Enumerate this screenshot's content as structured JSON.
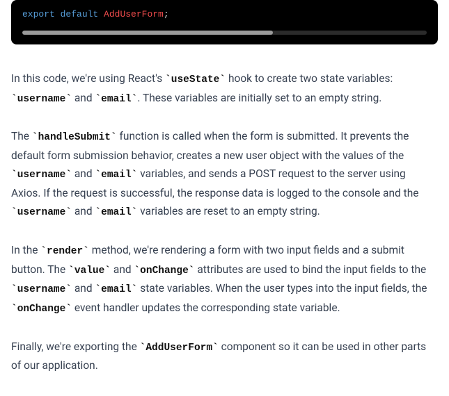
{
  "code_block": {
    "tokens": {
      "export": "export",
      "default": "default",
      "identifier": "AddUserForm",
      "terminator": ";"
    }
  },
  "paragraphs": {
    "p1": {
      "t1": "In this code, we're using React's ",
      "c1": "useState",
      "t2": " hook to create two state variables: ",
      "c2": "username",
      "t3": " and ",
      "c3": "email",
      "t4": ". These variables are initially set to an empty string."
    },
    "p2": {
      "t1": "The ",
      "c1": "handleSubmit",
      "t2": " function is called when the form is submitted. It prevents the default form submission behavior, creates a new user object with the values of the ",
      "c2": "username",
      "t3": " and ",
      "c3": "email",
      "t4": " variables, and sends a POST request to the server using Axios. If the request is successful, the response data is logged to the console and the ",
      "c4": "username",
      "t5": " and ",
      "c5": "email",
      "t6": " variables are reset to an empty string."
    },
    "p3": {
      "t1": "In the ",
      "c1": "render",
      "t2": " method, we're rendering a form with two input fields and a submit button. The ",
      "c2": "value",
      "t3": " and ",
      "c3": "onChange",
      "t4": " attributes are used to bind the input fields to the ",
      "c4": "username",
      "t5": " and ",
      "c5": "email",
      "t6": " state variables. When the user types into the input fields, the ",
      "c6": "onChange",
      "t7": " event handler updates the corresponding state variable."
    },
    "p4": {
      "t1": "Finally, we're exporting the ",
      "c1": "AddUserForm",
      "t2": " component so it can be used in other parts of our application."
    }
  }
}
